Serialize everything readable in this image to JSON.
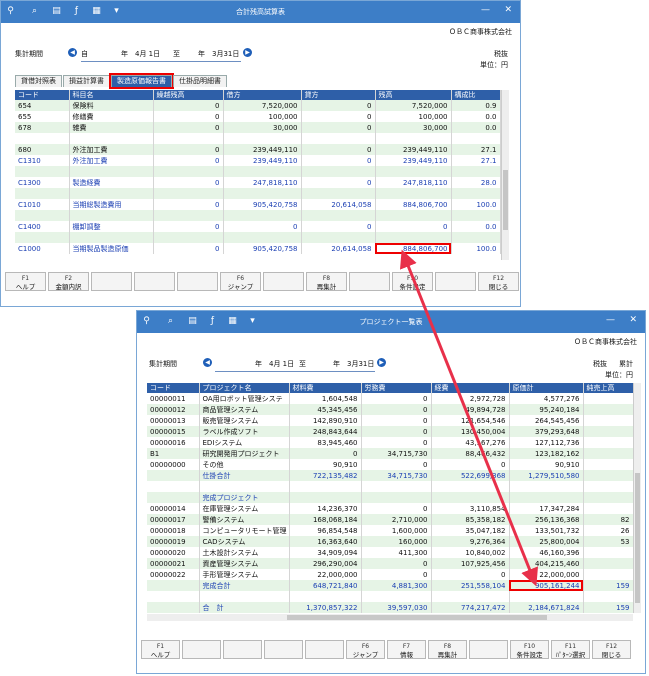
{
  "toolbar_icons": [
    "search-zoom-icon",
    "magnify-icon",
    "print-icon",
    "formula-icon",
    "export-icon",
    "dropdown-icon"
  ],
  "w1": {
    "title": "合計残高試算表",
    "company": "ＯＢＣ商事株式会社",
    "period_label": "集計期間",
    "from_prefix": "自",
    "from_date": "年　4月 1日",
    "to_prefix": "至",
    "to_date": "年　3月31日",
    "tax_mode": "税抜",
    "unit": "単位：円",
    "tabs": [
      "貸借対照表",
      "損益計算書",
      "製造原価報告書",
      "仕掛品明細書"
    ],
    "headers": [
      "コード",
      "科目名",
      "繰越残高",
      "借方",
      "貸方",
      "残高",
      "構成比"
    ],
    "rows": [
      {
        "style": "g",
        "c": [
          "654",
          "保険料",
          "0",
          "7,520,000",
          "0",
          "7,520,000",
          "0.9"
        ]
      },
      {
        "style": "w",
        "c": [
          "655",
          "修繕費",
          "0",
          "100,000",
          "0",
          "100,000",
          "0.0"
        ]
      },
      {
        "style": "g",
        "c": [
          "678",
          "雑費",
          "0",
          "30,000",
          "0",
          "30,000",
          "0.0"
        ]
      },
      {
        "style": "w",
        "c": [
          "",
          "",
          "",
          "",
          "",
          "",
          ""
        ]
      },
      {
        "style": "g",
        "c": [
          "680",
          "外注加工費",
          "0",
          "239,449,110",
          "0",
          "239,449,110",
          "27.1"
        ]
      },
      {
        "style": "w blue",
        "c": [
          "C1310",
          "外注加工費",
          "0",
          "239,449,110",
          "0",
          "239,449,110",
          "27.1"
        ]
      },
      {
        "style": "g",
        "c": [
          "",
          "",
          "",
          "",
          "",
          "",
          ""
        ]
      },
      {
        "style": "w blue",
        "c": [
          "C1300",
          "製造経費",
          "0",
          "247,818,110",
          "0",
          "247,818,110",
          "28.0"
        ]
      },
      {
        "style": "g",
        "c": [
          "",
          "",
          "",
          "",
          "",
          "",
          ""
        ]
      },
      {
        "style": "w blue",
        "c": [
          "C1010",
          "当期総製造費用",
          "0",
          "905,420,758",
          "20,614,058",
          "884,806,700",
          "100.0"
        ]
      },
      {
        "style": "g",
        "c": [
          "",
          "",
          "",
          "",
          "",
          "",
          ""
        ]
      },
      {
        "style": "w blue",
        "c": [
          "C1400",
          "棚卸調整",
          "0",
          "0",
          "0",
          "0",
          "0.0"
        ]
      },
      {
        "style": "g",
        "c": [
          "",
          "",
          "",
          "",
          "",
          "",
          ""
        ]
      },
      {
        "style": "w blue hl",
        "c": [
          "C1000",
          "当期製品製造原価",
          "0",
          "905,420,758",
          "20,614,058",
          "884,806,700",
          "100.0"
        ]
      }
    ],
    "fkeys": [
      {
        "k": "F1",
        "t": "ヘルプ"
      },
      {
        "k": "F2",
        "t": "金額内訳"
      },
      {
        "k": "",
        "t": ""
      },
      {
        "k": "",
        "t": ""
      },
      {
        "k": "",
        "t": ""
      },
      {
        "k": "F6",
        "t": "ジャンプ"
      },
      {
        "k": "",
        "t": ""
      },
      {
        "k": "F8",
        "t": "再集計"
      },
      {
        "k": "",
        "t": ""
      },
      {
        "k": "F10",
        "t": "条件設定"
      },
      {
        "k": "",
        "t": ""
      },
      {
        "k": "F12",
        "t": "閉じる"
      }
    ]
  },
  "w2": {
    "title": "プロジェクト一覧表",
    "company": "ＯＢＣ商事株式会社",
    "period_label": "集計期間",
    "from_date": "年　4月 1日",
    "to_prefix": "至",
    "to_date": "年　3月31日",
    "tax_mode": "税抜",
    "agg_mode": "累計",
    "unit": "単位：円",
    "headers": [
      "コード",
      "プロジェクト名",
      "材料費",
      "労務費",
      "経費",
      "原価計",
      "純売上高"
    ],
    "rows": [
      {
        "style": "w",
        "c": [
          "00000011",
          "OA用ロボット管理システ",
          "1,604,548",
          "0",
          "2,972,728",
          "4,577,276",
          ""
        ]
      },
      {
        "style": "g",
        "c": [
          "00000012",
          "商品管理システム",
          "45,345,456",
          "0",
          "49,894,728",
          "95,240,184",
          ""
        ]
      },
      {
        "style": "w",
        "c": [
          "00000013",
          "販売管理システム",
          "142,890,910",
          "0",
          "121,654,546",
          "264,545,456",
          ""
        ]
      },
      {
        "style": "g",
        "c": [
          "00000015",
          "ラベル作成ソフト",
          "248,843,644",
          "0",
          "130,450,004",
          "379,293,648",
          ""
        ]
      },
      {
        "style": "w",
        "c": [
          "00000016",
          "EDIシステム",
          "83,945,460",
          "0",
          "43,167,276",
          "127,112,736",
          ""
        ]
      },
      {
        "style": "g",
        "c": [
          "B1",
          "研究開発用プロジェクト",
          "0",
          "34,715,730",
          "88,466,432",
          "123,182,162",
          ""
        ]
      },
      {
        "style": "w",
        "c": [
          "00000000",
          "その他",
          "90,910",
          "0",
          "0",
          "90,910",
          ""
        ]
      },
      {
        "style": "g blue",
        "c": [
          "",
          "仕掛合計",
          "722,135,482",
          "34,715,730",
          "522,699,368",
          "1,279,510,580",
          ""
        ]
      },
      {
        "style": "w",
        "c": [
          "",
          "",
          "",
          "",
          "",
          "",
          ""
        ]
      },
      {
        "style": "g blue",
        "c": [
          "",
          "完成プロジェクト",
          "",
          "",
          "",
          "",
          ""
        ]
      },
      {
        "style": "w",
        "c": [
          "00000014",
          "在庫管理システム",
          "14,236,370",
          "0",
          "3,110,854",
          "17,347,284",
          ""
        ]
      },
      {
        "style": "g",
        "c": [
          "00000017",
          "警備システム",
          "168,068,184",
          "2,710,000",
          "85,358,182",
          "256,136,368",
          "82"
        ]
      },
      {
        "style": "w",
        "c": [
          "00000018",
          "コンピュータリモート管理",
          "96,854,548",
          "1,600,000",
          "35,047,182",
          "133,501,732",
          "26"
        ]
      },
      {
        "style": "g",
        "c": [
          "00000019",
          "CADシステム",
          "16,363,640",
          "160,000",
          "9,276,364",
          "25,800,004",
          "53"
        ]
      },
      {
        "style": "w",
        "c": [
          "00000020",
          "土木設計システム",
          "34,909,094",
          "411,300",
          "10,840,002",
          "46,160,396",
          ""
        ]
      },
      {
        "style": "g",
        "c": [
          "00000021",
          "資産管理システム",
          "296,290,004",
          "0",
          "107,925,456",
          "404,215,460",
          ""
        ]
      },
      {
        "style": "w",
        "c": [
          "00000022",
          "手形管理システム",
          "22,000,000",
          "0",
          "0",
          "22,000,000",
          ""
        ]
      },
      {
        "style": "g blue hl",
        "c": [
          "",
          "完成合計",
          "648,721,840",
          "4,881,300",
          "251,558,104",
          "905,161,244",
          "159"
        ]
      },
      {
        "style": "w",
        "c": [
          "",
          "",
          "",
          "",
          "",
          "",
          ""
        ]
      },
      {
        "style": "g blue",
        "c": [
          "",
          "合　計",
          "1,370,857,322",
          "39,597,030",
          "774,217,472",
          "2,184,671,824",
          "159"
        ]
      }
    ],
    "fkeys": [
      {
        "k": "F1",
        "t": "ヘルプ"
      },
      {
        "k": "",
        "t": ""
      },
      {
        "k": "",
        "t": ""
      },
      {
        "k": "",
        "t": ""
      },
      {
        "k": "",
        "t": ""
      },
      {
        "k": "F6",
        "t": "ジャンプ"
      },
      {
        "k": "F7",
        "t": "情報"
      },
      {
        "k": "F8",
        "t": "再集計"
      },
      {
        "k": "",
        "t": ""
      },
      {
        "k": "F10",
        "t": "条件設定"
      },
      {
        "k": "F11",
        "t": "ﾊﾟﾀｰﾝ選択"
      },
      {
        "k": "F12",
        "t": "閉じる"
      }
    ]
  },
  "colors": {
    "titlebar": "#3d7ec7",
    "header": "#2e5fa8",
    "highlight": "#e00000",
    "stripe": "#e6f4e6",
    "blue_text": "#1b3fb3"
  }
}
